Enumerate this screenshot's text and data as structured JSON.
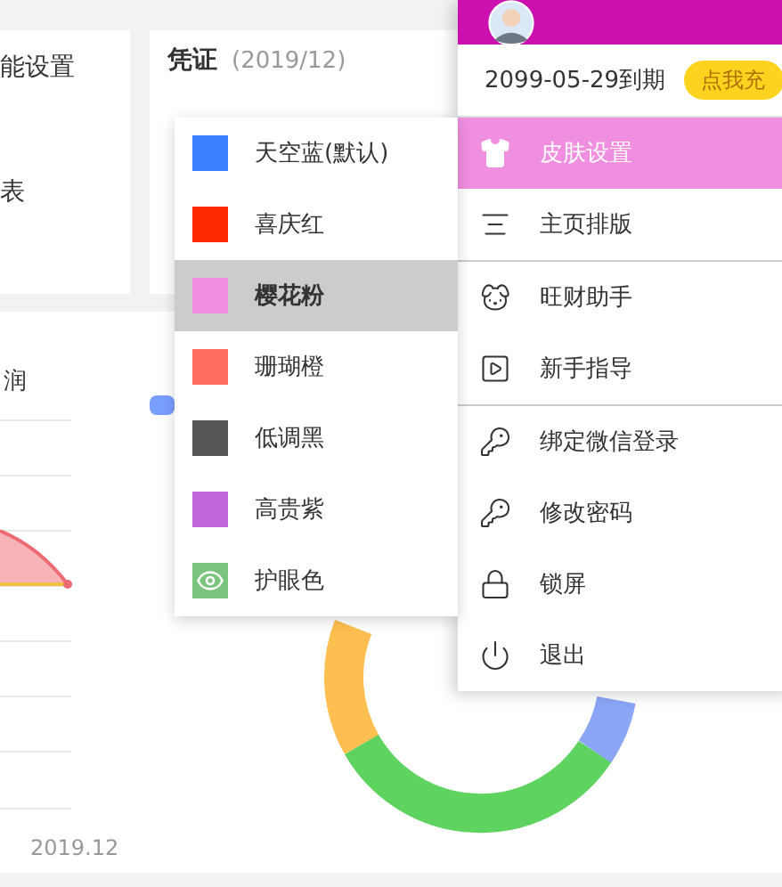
{
  "left_card": {
    "items": [
      "能设置",
      "表"
    ]
  },
  "voucher_card": {
    "title": "凭证",
    "period": "(2019/12)"
  },
  "profit_chart": {
    "title": "润",
    "x_label": "2019.12"
  },
  "account_menu": {
    "expiry": "2099-05-29到期",
    "recharge_button": "点我充",
    "items": [
      {
        "label": "皮肤设置",
        "kind": "shirt",
        "selected": true,
        "divider_after": false
      },
      {
        "label": "主页排版",
        "kind": "layout",
        "selected": false,
        "divider_after": true
      },
      {
        "label": "旺财助手",
        "kind": "dog",
        "selected": false,
        "divider_after": false
      },
      {
        "label": "新手指导",
        "kind": "video",
        "selected": false,
        "divider_after": true
      },
      {
        "label": "绑定微信登录",
        "kind": "key",
        "selected": false,
        "divider_after": false
      },
      {
        "label": "修改密码",
        "kind": "key",
        "selected": false,
        "divider_after": false
      },
      {
        "label": "锁屏",
        "kind": "lock",
        "selected": false,
        "divider_after": false
      },
      {
        "label": "退出",
        "kind": "power",
        "selected": false,
        "divider_after": false
      }
    ]
  },
  "skin_menu": {
    "items": [
      {
        "label": "天空蓝(默认)",
        "kind": "swatch",
        "color": "#3a7fff",
        "selected": false
      },
      {
        "label": "喜庆红",
        "kind": "swatch",
        "color": "#ff2a00",
        "selected": false
      },
      {
        "label": "樱花粉",
        "kind": "swatch",
        "color": "#f08ee0",
        "selected": true
      },
      {
        "label": "珊瑚橙",
        "kind": "swatch",
        "color": "#ff6f61",
        "selected": false
      },
      {
        "label": "低调黑",
        "kind": "swatch",
        "color": "#555555",
        "selected": false
      },
      {
        "label": "高贵紫",
        "kind": "swatch",
        "color": "#c266d9",
        "selected": false
      },
      {
        "label": "护眼色",
        "kind": "eye",
        "color": "#7bc47f",
        "selected": false
      }
    ]
  }
}
